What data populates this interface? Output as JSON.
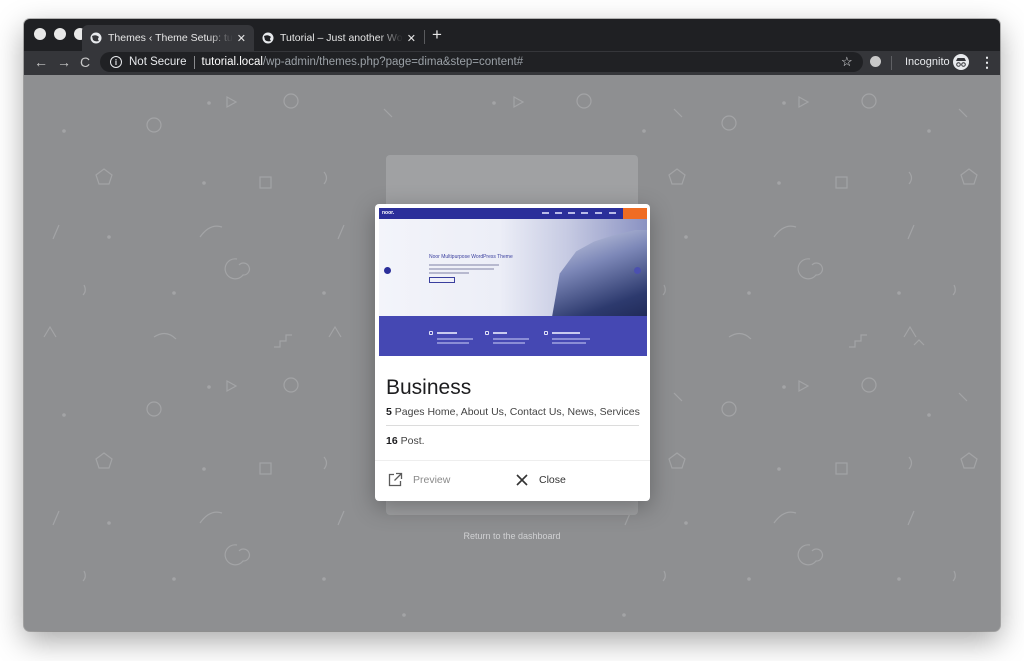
{
  "browser": {
    "tabs": [
      {
        "title": "Themes ‹ Theme Setup: tutorial",
        "active": true
      },
      {
        "title": "Tutorial – Just another WordPress",
        "active": false
      }
    ],
    "new_tab_label": "+",
    "security_label": "Not Secure",
    "url_host": "tutorial.local",
    "url_path": "/wp-admin/themes.php?page=dima&step=content#",
    "incognito_label": "Incognito"
  },
  "page": {
    "return_link": "Return to the dashboard"
  },
  "modal": {
    "preview_image": {
      "logo_text": "noor.",
      "hero_title": "Noor Multipurpose WordPress Theme",
      "brand_color": "#2b2f9a",
      "accent_color": "#ef6c23"
    },
    "theme_name": "Business",
    "pages_count": "5",
    "pages_list": " Pages Home, About Us, Contact Us, News, Services",
    "posts_count": "16",
    "posts_suffix": " Post.",
    "preview_label": "Preview",
    "close_label": "Close"
  }
}
